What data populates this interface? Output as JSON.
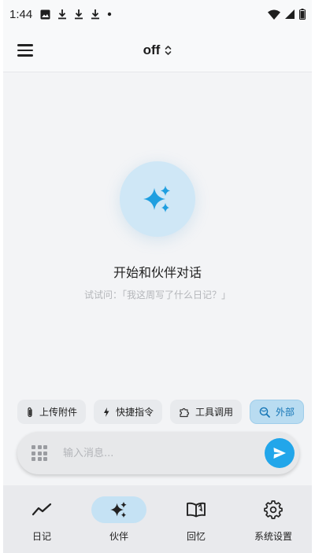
{
  "status_bar": {
    "time": "1:44",
    "icons": [
      "image-icon",
      "download-icon",
      "download-icon",
      "download-icon",
      "dot-icon"
    ],
    "right_icons": [
      "wifi-icon",
      "signal-icon",
      "battery-icon"
    ]
  },
  "header": {
    "menu_icon": "hamburger-menu-icon",
    "model_label": "off",
    "dropdown_icon": "unfold-chevron-icon"
  },
  "empty_state": {
    "icon": "sparkles-icon",
    "title": "开始和伙伴对话",
    "subtitle": "试试问：「我这周写了什么日记？」"
  },
  "chips": [
    {
      "icon": "paperclip-icon",
      "label": "上传附件"
    },
    {
      "icon": "lightning-icon",
      "label": "快捷指令"
    },
    {
      "icon": "puzzle-icon",
      "label": "工具调用"
    },
    {
      "icon": "globe-search-icon",
      "label": "外部"
    }
  ],
  "input": {
    "placeholder": "输入消息..."
  },
  "bottom_nav": {
    "items": [
      {
        "icon": "trend-line-icon",
        "label": "日记",
        "active": false
      },
      {
        "icon": "sparkles-icon",
        "label": "伙伴",
        "active": true
      },
      {
        "icon": "book-icon",
        "label": "回忆",
        "active": false
      },
      {
        "icon": "gear-icon",
        "label": "系统设置",
        "active": false
      }
    ]
  },
  "colors": {
    "accent": "#22a6ea",
    "accent_soft": "#c5e2f4",
    "background": "#f3f4f6",
    "nav_background": "#e9eaed"
  }
}
